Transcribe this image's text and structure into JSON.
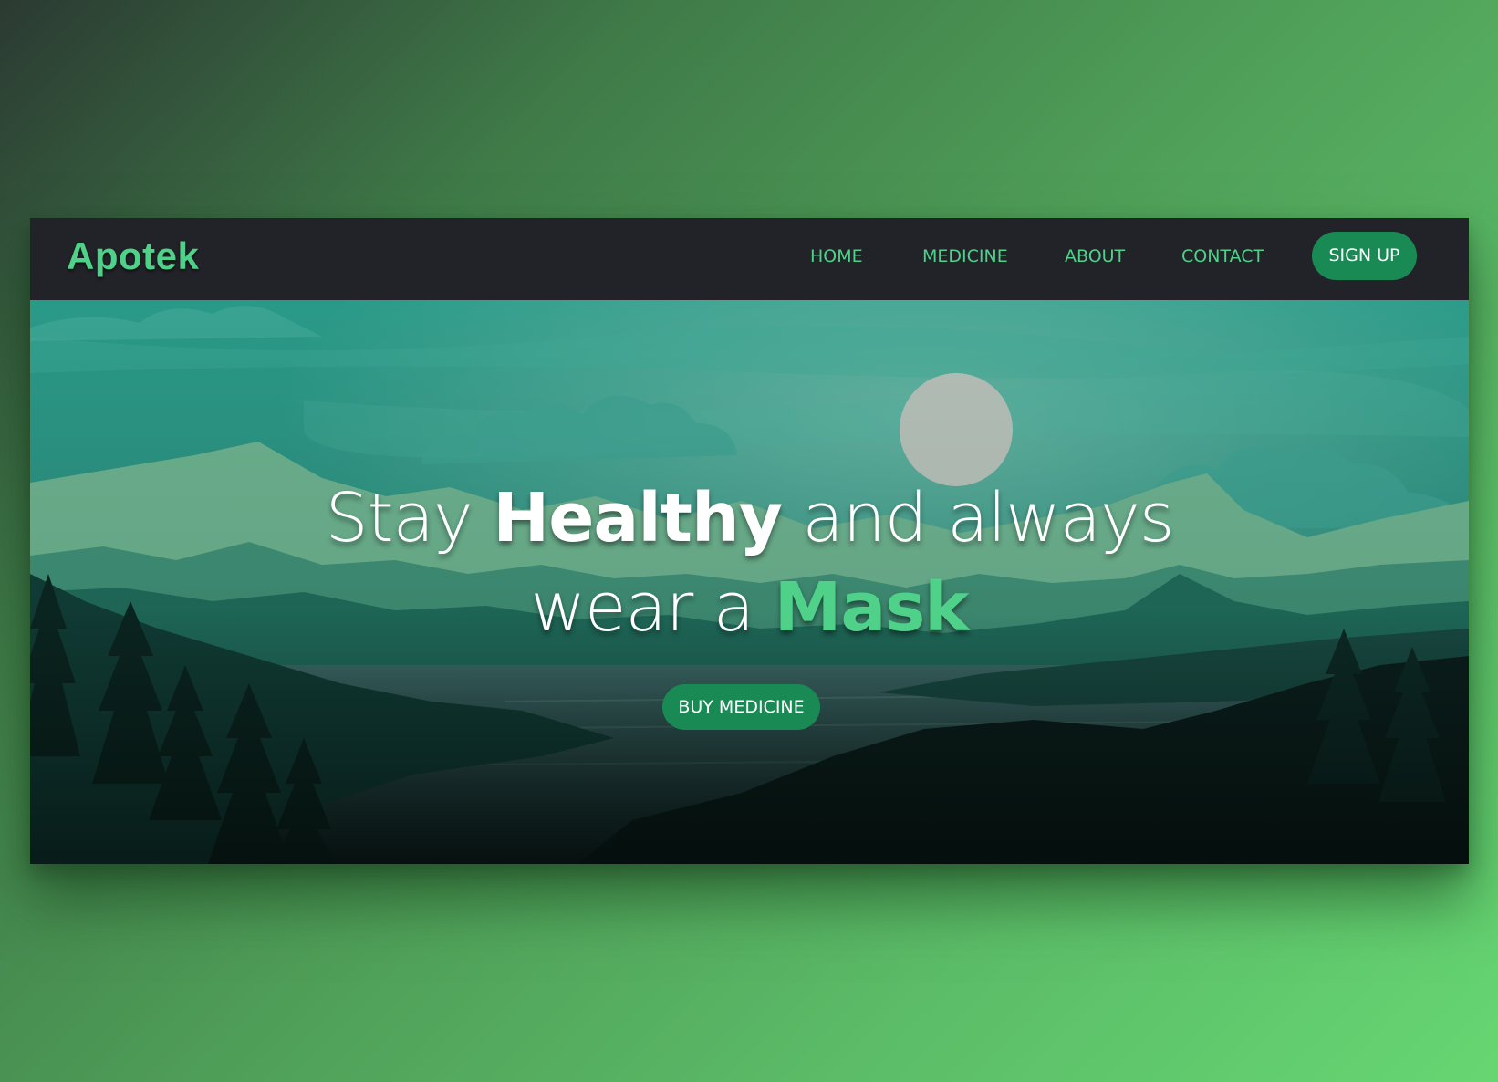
{
  "brand": {
    "name": "Apotek"
  },
  "nav": {
    "items": [
      {
        "label": "HOME"
      },
      {
        "label": "MEDICINE"
      },
      {
        "label": "ABOUT"
      },
      {
        "label": "CONTACT"
      }
    ],
    "signup_label": "SIGN UP"
  },
  "hero": {
    "line1": {
      "word1": "Stay",
      "word2": "Healthy",
      "word3": "and always"
    },
    "line2": {
      "word1": "wear a",
      "word2": "Mask"
    },
    "cta_label": "BUY MEDICINE"
  },
  "colors": {
    "accent": "#4fd18a",
    "button": "#1a8a55",
    "navbar": "#212328"
  }
}
